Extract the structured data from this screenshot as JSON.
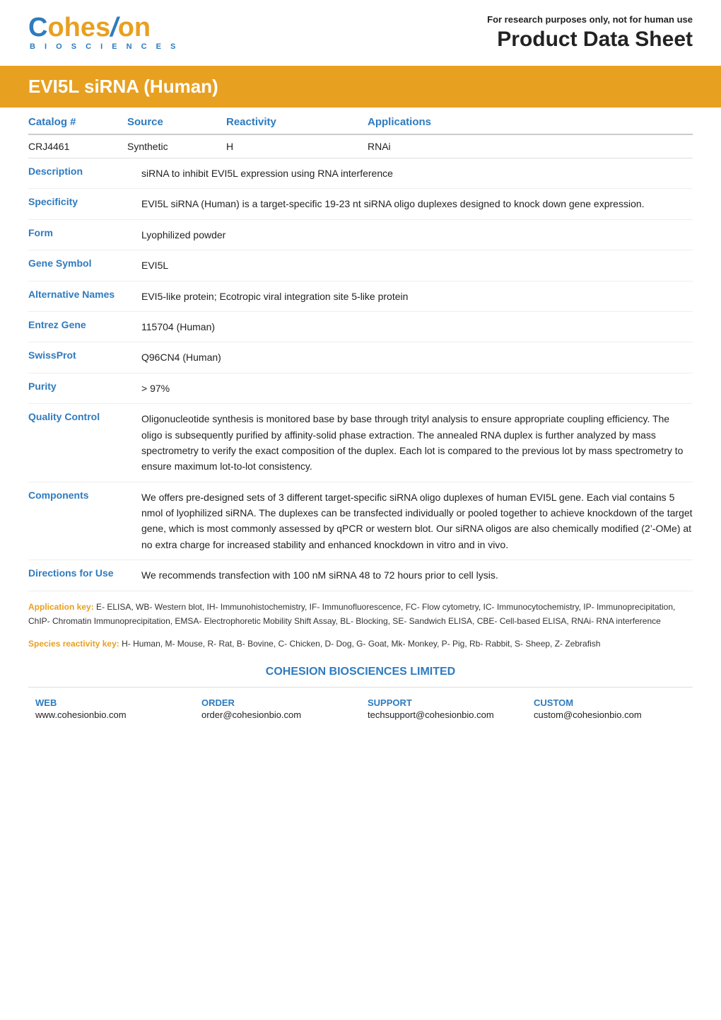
{
  "header": {
    "for_research": "For research purposes only, not for human use",
    "product_data_sheet": "Product Data Sheet",
    "logo_c": "C",
    "logo_ohesion": "ohes",
    "logo_slash": "/",
    "logo_on": "on",
    "biosciences": "B I O S C I E N C E S"
  },
  "title": {
    "text": "EVI5L siRNA (Human)"
  },
  "columns": {
    "catalog": "Catalog #",
    "source": "Source",
    "reactivity": "Reactivity",
    "applications": "Applications"
  },
  "product_row": {
    "catalog": "CRJ4461",
    "source": "Synthetic",
    "reactivity": "H",
    "applications": "RNAi"
  },
  "fields": [
    {
      "label": "Description",
      "value": "siRNA to inhibit EVI5L expression using RNA interference"
    },
    {
      "label": "Specificity",
      "value": "EVI5L siRNA (Human) is a target-specific 19-23 nt siRNA oligo duplexes designed to knock down gene expression."
    },
    {
      "label": "Form",
      "value": "Lyophilized powder"
    },
    {
      "label": "Gene Symbol",
      "value": "EVI5L"
    },
    {
      "label": "Alternative Names",
      "value": "EVI5-like protein; Ecotropic viral integration site 5-like protein"
    },
    {
      "label": "Entrez Gene",
      "value": "115704 (Human)"
    },
    {
      "label": "SwissProt",
      "value": "Q96CN4 (Human)"
    },
    {
      "label": "Purity",
      "value": "> 97%"
    },
    {
      "label": "Quality Control",
      "value": "Oligonucleotide synthesis is monitored base by base through trityl analysis to ensure appropriate coupling efficiency. The oligo is subsequently purified by affinity-solid phase extraction. The annealed RNA duplex is further analyzed by mass spectrometry to verify the exact composition of the duplex. Each lot is compared to the previous lot by mass spectrometry to ensure maximum lot-to-lot consistency."
    },
    {
      "label": "Components",
      "value": "We offers pre-designed sets of 3 different target-specific siRNA oligo duplexes of human EVI5L gene. Each vial contains 5 nmol of lyophilized siRNA. The duplexes can be transfected individually or pooled together to achieve knockdown of the target gene, which is most commonly assessed by qPCR or western blot. Our siRNA oligos are also chemically modified (2’-OMe) at no extra charge for increased stability and enhanced knockdown in vitro and in vivo."
    },
    {
      "label": "Directions for Use",
      "value": "We recommends transfection with 100 nM siRNA 48 to 72 hours prior to cell lysis."
    }
  ],
  "app_key": {
    "label": "Application key:",
    "text": "E- ELISA, WB- Western blot, IH- Immunohistochemistry, IF- Immunofluorescence, FC- Flow cytometry, IC- Immunocytochemistry, IP- Immunoprecipitation, ChIP- Chromatin Immunoprecipitation, EMSA- Electrophoretic Mobility Shift Assay, BL- Blocking, SE- Sandwich ELISA, CBE- Cell-based ELISA, RNAi- RNA interference"
  },
  "species_key": {
    "label": "Species reactivity key:",
    "text": "H- Human, M- Mouse, R- Rat, B- Bovine, C- Chicken, D- Dog, G- Goat, Mk- Monkey, P- Pig, Rb- Rabbit, S- Sheep, Z- Zebrafish"
  },
  "footer": {
    "company": "COHESION BIOSCIENCES LIMITED",
    "columns": [
      {
        "label": "WEB",
        "value": "www.cohesionbio.com"
      },
      {
        "label": "ORDER",
        "value": "order@cohesionbio.com"
      },
      {
        "label": "SUPPORT",
        "value": "techsupport@cohesionbio.com"
      },
      {
        "label": "CUSTOM",
        "value": "custom@cohesionbio.com"
      }
    ]
  }
}
